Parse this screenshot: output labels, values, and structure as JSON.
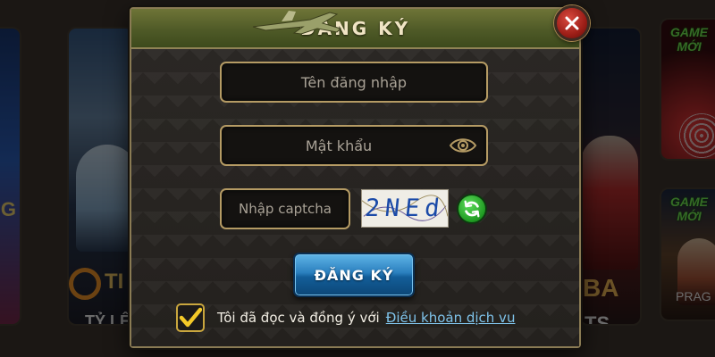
{
  "background": {
    "left_card": {
      "brand": "TI",
      "subtitle": "TỶ LỆ"
    },
    "left_edge_card": {
      "letter": "G"
    },
    "right_card": {
      "brand": "BA",
      "subtitle": "TS"
    },
    "game_cards": [
      {
        "badge": "GAME MỚI"
      },
      {
        "badge": "GAME MỚI",
        "provider": "PRAG"
      }
    ]
  },
  "dialog": {
    "title": "ĐĂNG KÝ",
    "close_icon": "close-icon",
    "username": {
      "placeholder": "Tên đăng nhập",
      "value": ""
    },
    "password": {
      "placeholder": "Mật khẩu",
      "value": "",
      "toggle_icon": "eye-icon"
    },
    "captcha": {
      "placeholder": "Nhập captcha",
      "value": "",
      "image_text": "2NEd",
      "refresh_icon": "refresh-icon"
    },
    "submit_label": "ĐĂNG KÝ",
    "agreement": {
      "checked": true,
      "text": "Tôi đã đọc và đồng ý với",
      "link": "Điều khoản dịch vu"
    }
  },
  "colors": {
    "header": "#4f5a27",
    "border_gold": "#b59b64",
    "button_blue": "#2a7fbe",
    "close_red": "#c0352c",
    "refresh_green": "#2fb32f",
    "checkbox_gold": "#c9a63e",
    "link_blue": "#7fc3ea"
  }
}
